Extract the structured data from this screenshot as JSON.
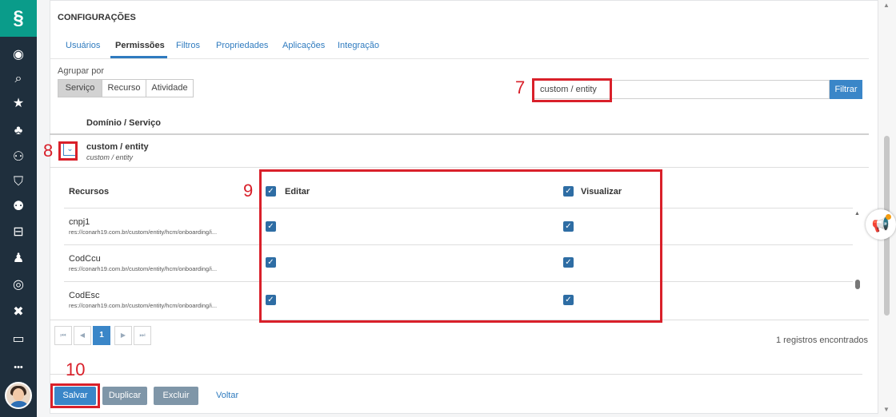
{
  "sidebar": {
    "logo": "§",
    "icons": [
      {
        "name": "user-circle-icon",
        "glyph": "◉"
      },
      {
        "name": "search-icon",
        "glyph": "⌕"
      },
      {
        "name": "star-icon",
        "glyph": "★"
      },
      {
        "name": "org-chart-icon",
        "glyph": "♣"
      },
      {
        "name": "people-icon",
        "glyph": "⚇"
      },
      {
        "name": "shield-icon",
        "glyph": "⛉"
      },
      {
        "name": "group-icon",
        "glyph": "⚉"
      },
      {
        "name": "briefcase-icon",
        "glyph": "⊟"
      },
      {
        "name": "person-desk-icon",
        "glyph": "♟"
      },
      {
        "name": "target-icon",
        "glyph": "◎"
      },
      {
        "name": "x-icon",
        "glyph": "✖"
      },
      {
        "name": "monitor-icon",
        "glyph": "▭"
      },
      {
        "name": "more-icon",
        "glyph": "•••"
      }
    ]
  },
  "page": {
    "title": "CONFIGURAÇÕES"
  },
  "tabs": [
    "Usuários",
    "Permissões",
    "Filtros",
    "Propriedades",
    "Aplicações",
    "Integração"
  ],
  "active_tab": "Permissões",
  "group_by": {
    "label": "Agrupar por",
    "options": [
      "Serviço",
      "Recurso",
      "Atividade"
    ],
    "selected": "Serviço"
  },
  "filter": {
    "value": "custom / entity",
    "button": "Filtrar"
  },
  "domain_header": "Domínio / Serviço",
  "group": {
    "name": "custom / entity",
    "sub": "custom / entity",
    "expand_glyph": "⌄"
  },
  "resources": {
    "header": "Recursos",
    "columns": [
      "Editar",
      "Visualizar"
    ],
    "check_glyph": "✓",
    "rows": [
      {
        "name": "cnpj1",
        "path": "res://conarh19.com.br/custom/entity/hcm/onboarding/i..."
      },
      {
        "name": "CodCcu",
        "path": "res://conarh19.com.br/custom/entity/hcm/onboarding/i..."
      },
      {
        "name": "CodEsc",
        "path": "res://conarh19.com.br/custom/entity/hcm/onboarding/i..."
      }
    ]
  },
  "pager": {
    "first": "⏮",
    "prev": "◀",
    "current": "1",
    "next": "▶",
    "last": "⏭",
    "records": "1 registros encontrados"
  },
  "actions": {
    "save": "Salvar",
    "duplicate": "Duplicar",
    "delete": "Excluir",
    "back": "Voltar"
  },
  "annotations": [
    "7",
    "8",
    "9",
    "10"
  ],
  "colors": {
    "accent": "#3a86c8",
    "sidebar": "#1f2f3d",
    "logo": "#0a9c8a",
    "annotation": "#d9202a"
  }
}
